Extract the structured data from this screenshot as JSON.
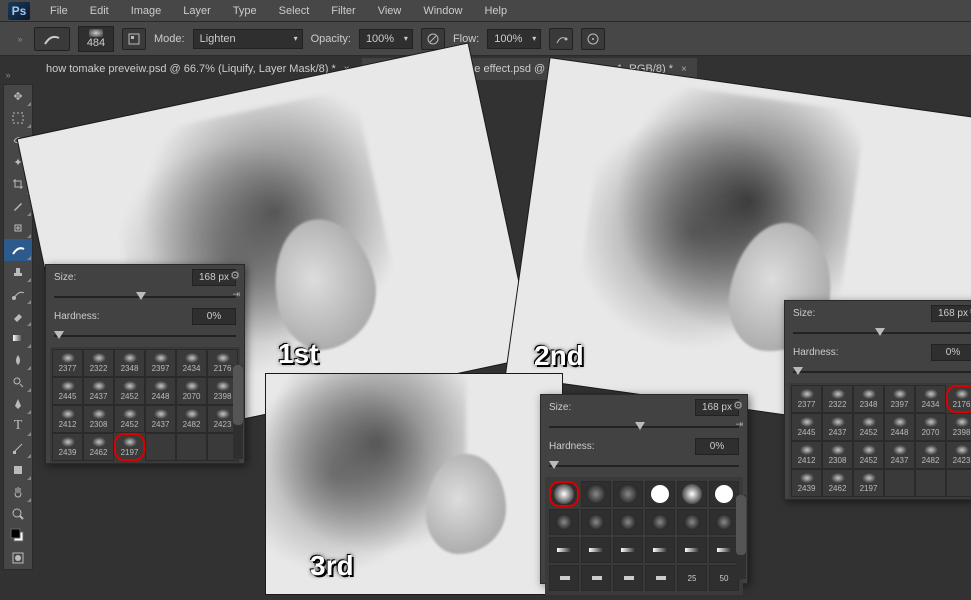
{
  "menu": {
    "file": "File",
    "edit": "Edit",
    "image": "Image",
    "layer": "Layer",
    "type": "Type",
    "select": "Select",
    "filter": "Filter",
    "view": "View",
    "window": "Window",
    "help": "Help"
  },
  "logo": "Ps",
  "options": {
    "brush_size": "484",
    "mode_label": "Mode:",
    "mode_value": "Lighten",
    "opacity_label": "Opacity:",
    "opacity_value": "100%",
    "flow_label": "Flow:",
    "flow_value": "100%"
  },
  "tabs": {
    "active": "how tomake preveiw.psd @ 66.7% (Liquify, Layer Mask/8) *",
    "inactive": "How to make a smoke effect.psd @ 66.7% (Layer 1, RGB/8) *"
  },
  "labels": {
    "first": "1st",
    "second": "2nd",
    "third": "3rd"
  },
  "panel": {
    "size_label": "Size:",
    "size_value": "168 px",
    "hardness_label": "Hardness:",
    "hardness_value": "0%"
  },
  "brushes1": [
    [
      "2377",
      "2322",
      "2348",
      "2397",
      "2434",
      "2176"
    ],
    [
      "2445",
      "2437",
      "2452",
      "2448",
      "2070",
      "2398"
    ],
    [
      "2412",
      "2308",
      "2452",
      "2437",
      "2482",
      "2423"
    ],
    [
      "2439",
      "2462",
      "2197",
      "",
      "",
      ""
    ]
  ],
  "brushes1_circled": [
    3,
    2
  ],
  "brushes2": [
    [
      "2377",
      "2322",
      "2348",
      "2397",
      "2434",
      "2176"
    ],
    [
      "2445",
      "2437",
      "2452",
      "2448",
      "2070",
      "2398"
    ],
    [
      "2412",
      "2308",
      "2452",
      "2437",
      "2482",
      "2423"
    ],
    [
      "2439",
      "2462",
      "2197",
      "",
      "",
      ""
    ]
  ],
  "brushes2_circled": [
    0,
    5
  ],
  "brushes3_row2": [
    "",
    "",
    "",
    "",
    "25",
    "50",
    ""
  ],
  "brushes3_circled": [
    0,
    0
  ]
}
